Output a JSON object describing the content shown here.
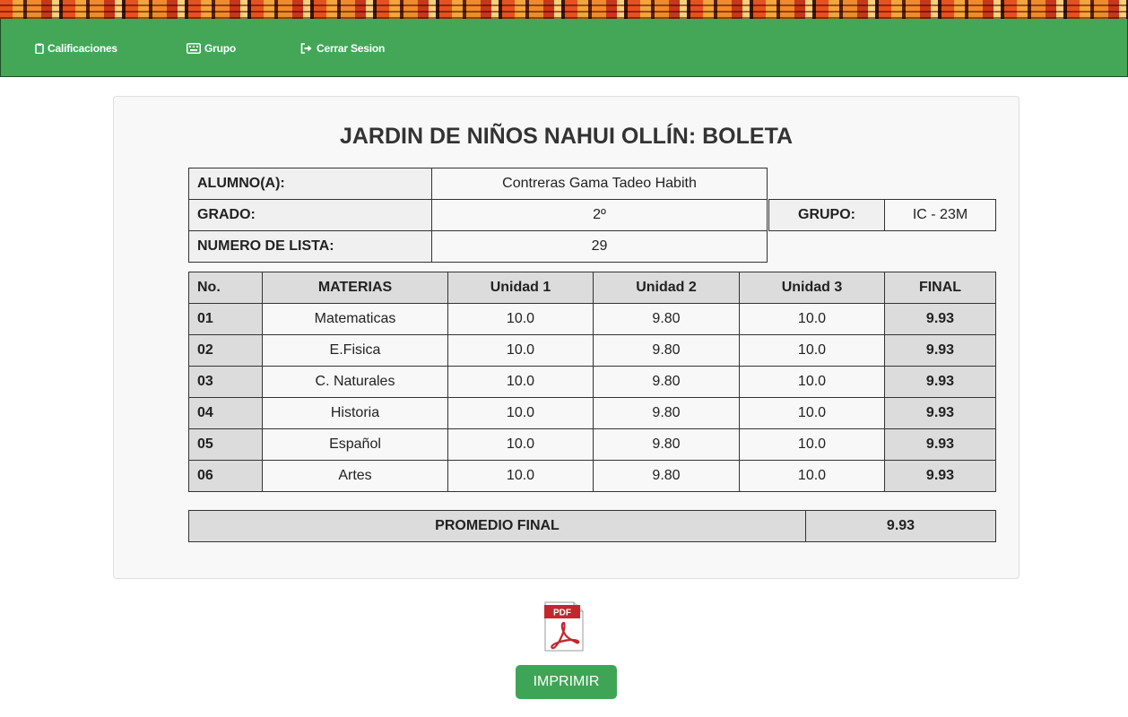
{
  "nav": {
    "items": [
      {
        "label": "Calificaciones",
        "icon": "clipboard-icon"
      },
      {
        "label": "Grupo",
        "icon": "keyboard-icon"
      },
      {
        "label": "Cerrar Sesion",
        "icon": "sign-out-icon"
      }
    ]
  },
  "report": {
    "title": "JARDIN DE NIÑOS NAHUI OLLÍN: BOLETA",
    "student_label": "ALUMNO(A):",
    "student_value": "Contreras Gama Tadeo Habith",
    "grade_label": "GRADO:",
    "grade_value": "2º",
    "group_label": "GRUPO:",
    "group_value": "IC - 23M",
    "list_label": "NUMERO DE LISTA:",
    "list_value": "29"
  },
  "grades": {
    "headers": [
      "No.",
      "MATERIAS",
      "Unidad 1",
      "Unidad 2",
      "Unidad 3",
      "FINAL"
    ],
    "rows": [
      [
        "01",
        "Matematicas",
        "10.0",
        "9.80",
        "10.0",
        "9.93"
      ],
      [
        "02",
        "E.Fisica",
        "10.0",
        "9.80",
        "10.0",
        "9.93"
      ],
      [
        "03",
        "C. Naturales",
        "10.0",
        "9.80",
        "10.0",
        "9.93"
      ],
      [
        "04",
        "Historia",
        "10.0",
        "9.80",
        "10.0",
        "9.93"
      ],
      [
        "05",
        "Español",
        "10.0",
        "9.80",
        "10.0",
        "9.93"
      ],
      [
        "06",
        "Artes",
        "10.0",
        "9.80",
        "10.0",
        "9.93"
      ]
    ]
  },
  "average": {
    "label": "PROMEDIO FINAL",
    "value": "9.93"
  },
  "pdf_icon": {
    "text": "PDF",
    "icon": "pdf-icon"
  },
  "print_button": "IMPRIMIR",
  "colors": {
    "nav_green": "#43a757",
    "button_green": "#3fa556",
    "pdf_red": "#c1272d"
  }
}
